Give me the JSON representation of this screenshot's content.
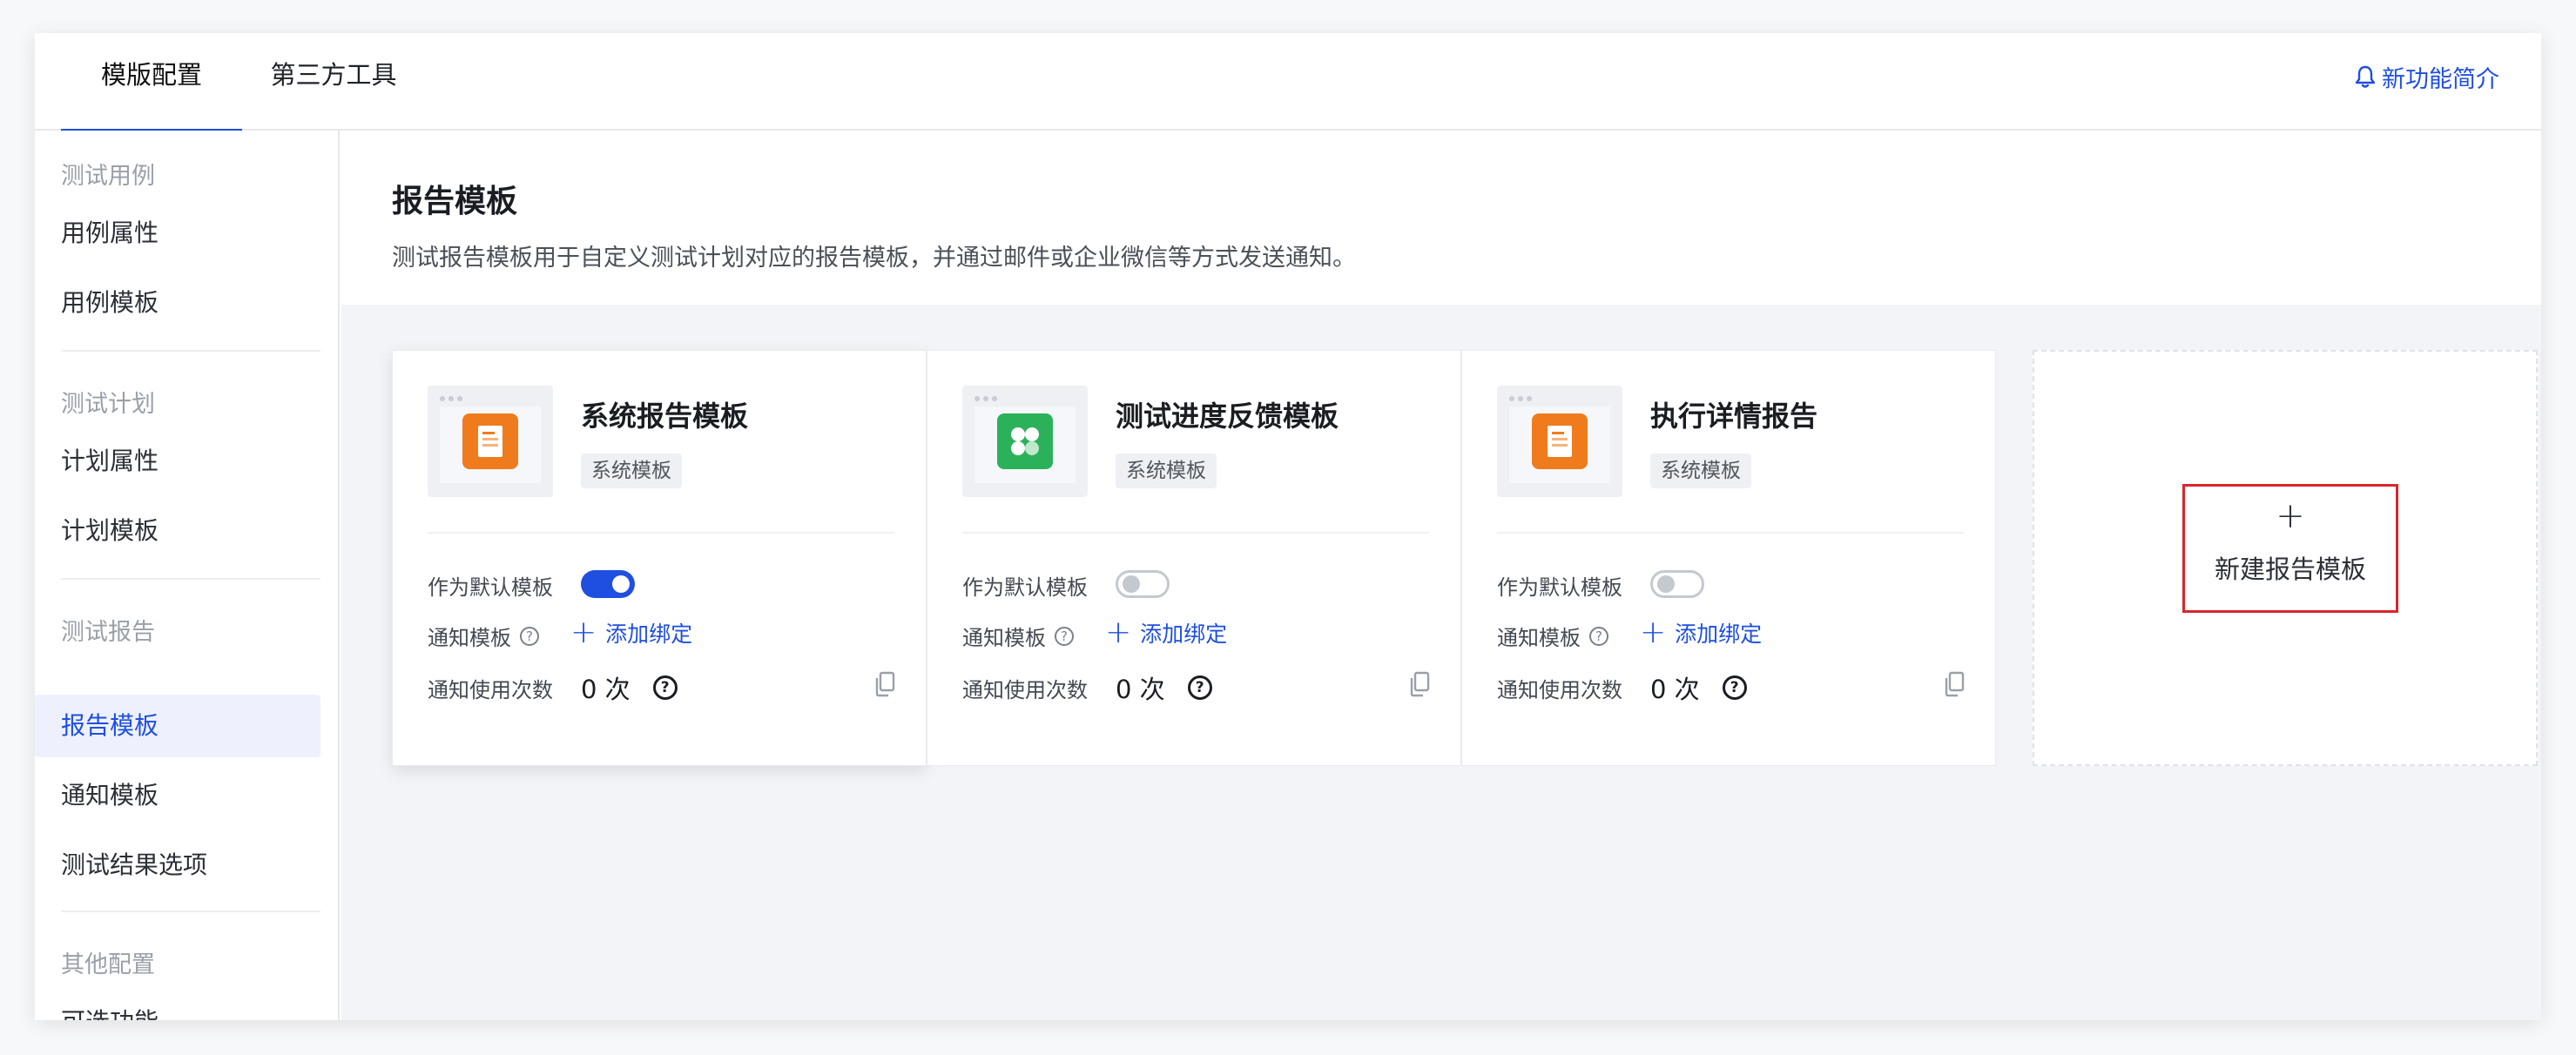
{
  "tabs": [
    {
      "label": "模版配置",
      "active": true
    },
    {
      "label": "第三方工具",
      "active": false
    }
  ],
  "whats_new": "新功能简介",
  "sidebar": {
    "groups": [
      {
        "label": "测试用例",
        "items": [
          "用例属性",
          "用例模板"
        ]
      },
      {
        "label": "测试计划",
        "items": [
          "计划属性",
          "计划模板"
        ]
      },
      {
        "label": "测试报告",
        "items": [
          "报告模板",
          "通知模板",
          "测试结果选项"
        ]
      },
      {
        "label": "其他配置",
        "items": [
          "可选功能"
        ]
      }
    ],
    "active_item": "报告模板"
  },
  "page": {
    "title": "报告模板",
    "description": "测试报告模板用于自定义测试计划对应的报告模板，并通过邮件或企业微信等方式发送通知。"
  },
  "labels": {
    "default_template": "作为默认模板",
    "notify_template": "通知模板",
    "add_binding": "添加绑定",
    "usage_count": "通知使用次数"
  },
  "cards": [
    {
      "title": "系统报告模板",
      "tag": "系统模板",
      "is_default": true,
      "count": "0 次",
      "icon": "orange-document-icon",
      "color": "#f07b1c"
    },
    {
      "title": "测试进度反馈模板",
      "tag": "系统模板",
      "is_default": false,
      "count": "0 次",
      "icon": "green-clover-icon",
      "color": "#2bb15a"
    },
    {
      "title": "执行详情报告",
      "tag": "系统模板",
      "is_default": false,
      "count": "0 次",
      "icon": "orange-document-icon",
      "color": "#f07b1c"
    }
  ],
  "new_template": {
    "plus": "+",
    "label": "新建报告模板"
  },
  "colors": {
    "primary": "#1f4fe0",
    "highlight_border": "#d8262c"
  }
}
